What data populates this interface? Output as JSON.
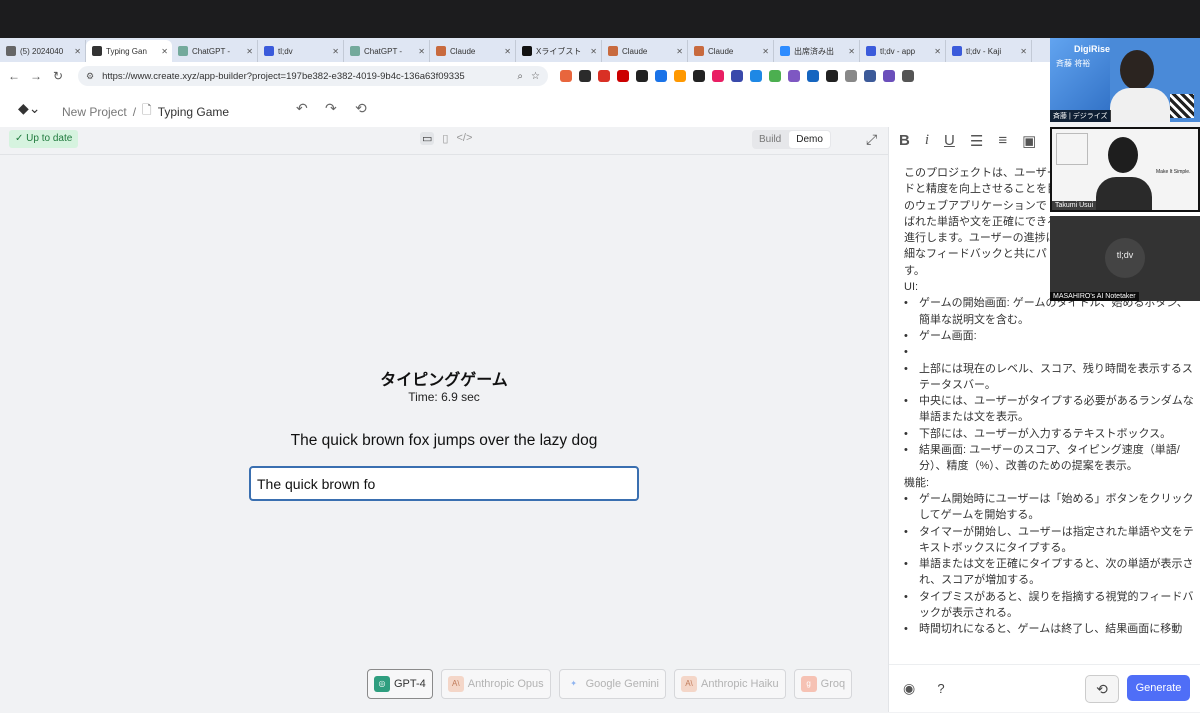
{
  "browser": {
    "tabs": [
      {
        "label": "(5) 2024040",
        "icon": "page-icon",
        "color": "#666666"
      },
      {
        "label": "Typing Gan",
        "icon": "create-logo-icon",
        "color": "#333333",
        "active": true
      },
      {
        "label": "ChatGPT - ",
        "icon": "chatgpt-icon",
        "color": "#74aa9c"
      },
      {
        "label": "tl;dv",
        "icon": "tldv-icon",
        "color": "#3b5bdb"
      },
      {
        "label": "ChatGPT - ",
        "icon": "chatgpt-icon",
        "color": "#74aa9c"
      },
      {
        "label": "Claude",
        "icon": "claude-icon",
        "color": "#c86a3e"
      },
      {
        "label": "Xライブスト",
        "icon": "x-icon",
        "color": "#111111"
      },
      {
        "label": "Claude",
        "icon": "claude-icon",
        "color": "#c86a3e"
      },
      {
        "label": "Claude",
        "icon": "claude-icon",
        "color": "#c86a3e"
      },
      {
        "label": "出席済み出",
        "icon": "zoom-icon",
        "color": "#2d8cff"
      },
      {
        "label": "tl;dv - app",
        "icon": "tldv-icon",
        "color": "#3b5bdb"
      },
      {
        "label": "tl;dv - Kaji",
        "icon": "tldv-icon",
        "color": "#3b5bdb"
      }
    ],
    "url": "https://www.create.xyz/app-builder?project=197be382-e382-4019-9b4c-136a63f09335",
    "extension_colors": [
      "#e8663d",
      "#2b2b2b",
      "#d93025",
      "#cc0000",
      "#222222",
      "#1a73e8",
      "#ff9800",
      "#222222",
      "#e91e63",
      "#3949ab",
      "#1e88e5",
      "#4caf50",
      "#7e57c2",
      "#1565c0",
      "#212121",
      "#888888",
      "#3c5a99",
      "#6b4fbb",
      "#555555"
    ]
  },
  "app": {
    "breadcrumb_root": "New Project",
    "breadcrumb_separator": "/",
    "project_name": "Typing Game",
    "status": "Up to date",
    "mode_build": "Build",
    "mode_demo": "Demo"
  },
  "game": {
    "title": "タイピングゲーム",
    "time": "Time: 6.9 sec",
    "sentence": "The quick brown fox jumps over the lazy dog",
    "input_value": "The quick brown fo"
  },
  "models": [
    {
      "label": "GPT-4",
      "icon": "openai-icon",
      "selected": true
    },
    {
      "label": "Anthropic Opus",
      "icon": "anthropic-icon"
    },
    {
      "label": "Google Gemini",
      "icon": "gemini-icon"
    },
    {
      "label": "Anthropic Haiku",
      "icon": "anthropic-icon"
    },
    {
      "label": "Groq",
      "icon": "groq-icon"
    }
  ],
  "editor": {
    "paragraphs": [
      {
        "text": "このプロジェクトは、ユーザー",
        "bullet": false
      },
      {
        "text": "ドと精度を向上させることを目",
        "bullet": false
      },
      {
        "text": "のウェブアプリケーションで",
        "bullet": false
      },
      {
        "text": "ばれた単語や文を正確にできる",
        "bullet": false
      },
      {
        "text": "進行します。ユーザーの進捗は",
        "bullet": false
      },
      {
        "text": "細なフィードバックと共にパ",
        "bullet": false
      },
      {
        "text": "す。",
        "bullet": false
      },
      {
        "text": "UI:",
        "bullet": false
      },
      {
        "text": "ゲームの開始画面: ゲームのタイトル、始めるボタン、簡単な説明文を含む。",
        "bullet": true
      },
      {
        "text": "ゲーム画面:",
        "bullet": true
      },
      {
        "text": "",
        "bullet": true
      },
      {
        "text": "上部には現在のレベル、スコア、残り時間を表示するステータスバー。",
        "bullet": true
      },
      {
        "text": "中央には、ユーザーがタイプする必要があるランダムな単語または文を表示。",
        "bullet": true
      },
      {
        "text": "下部には、ユーザーが入力するテキストボックス。",
        "bullet": true
      },
      {
        "text": "結果画面: ユーザーのスコア、タイピング速度（単語/分）、精度（%）、改善のための提案を表示。",
        "bullet": true
      },
      {
        "text": "機能:",
        "bullet": false
      },
      {
        "text": "ゲーム開始時にユーザーは「始める」ボタンをクリックしてゲームを開始する。",
        "bullet": true
      },
      {
        "text": "タイマーが開始し、ユーザーは指定された単語や文をテキストボックスにタイプする。",
        "bullet": true
      },
      {
        "text": "単語または文を正確にタイプすると、次の単語が表示され、スコアが増加する。",
        "bullet": true
      },
      {
        "text": "タイプミスがあると、誤りを指摘する視覚的フィードバックが表示される。",
        "bullet": true
      },
      {
        "text": "時間切れになると、ゲームは終了し、結果画面に移動",
        "bullet": true
      }
    ],
    "generate_label": "Generate",
    "help_label": "?"
  },
  "videos": {
    "v1_brand": "DigiRise",
    "v1_name": "斉藤 将裕",
    "v1_caption": "斉藤 | デジライズ",
    "v2_caption": "Takumi Usui",
    "v2_note": "Make It Simple.",
    "v3_logo": "tl;dv",
    "v3_caption": "MASAHIRO's AI Notetaker"
  }
}
